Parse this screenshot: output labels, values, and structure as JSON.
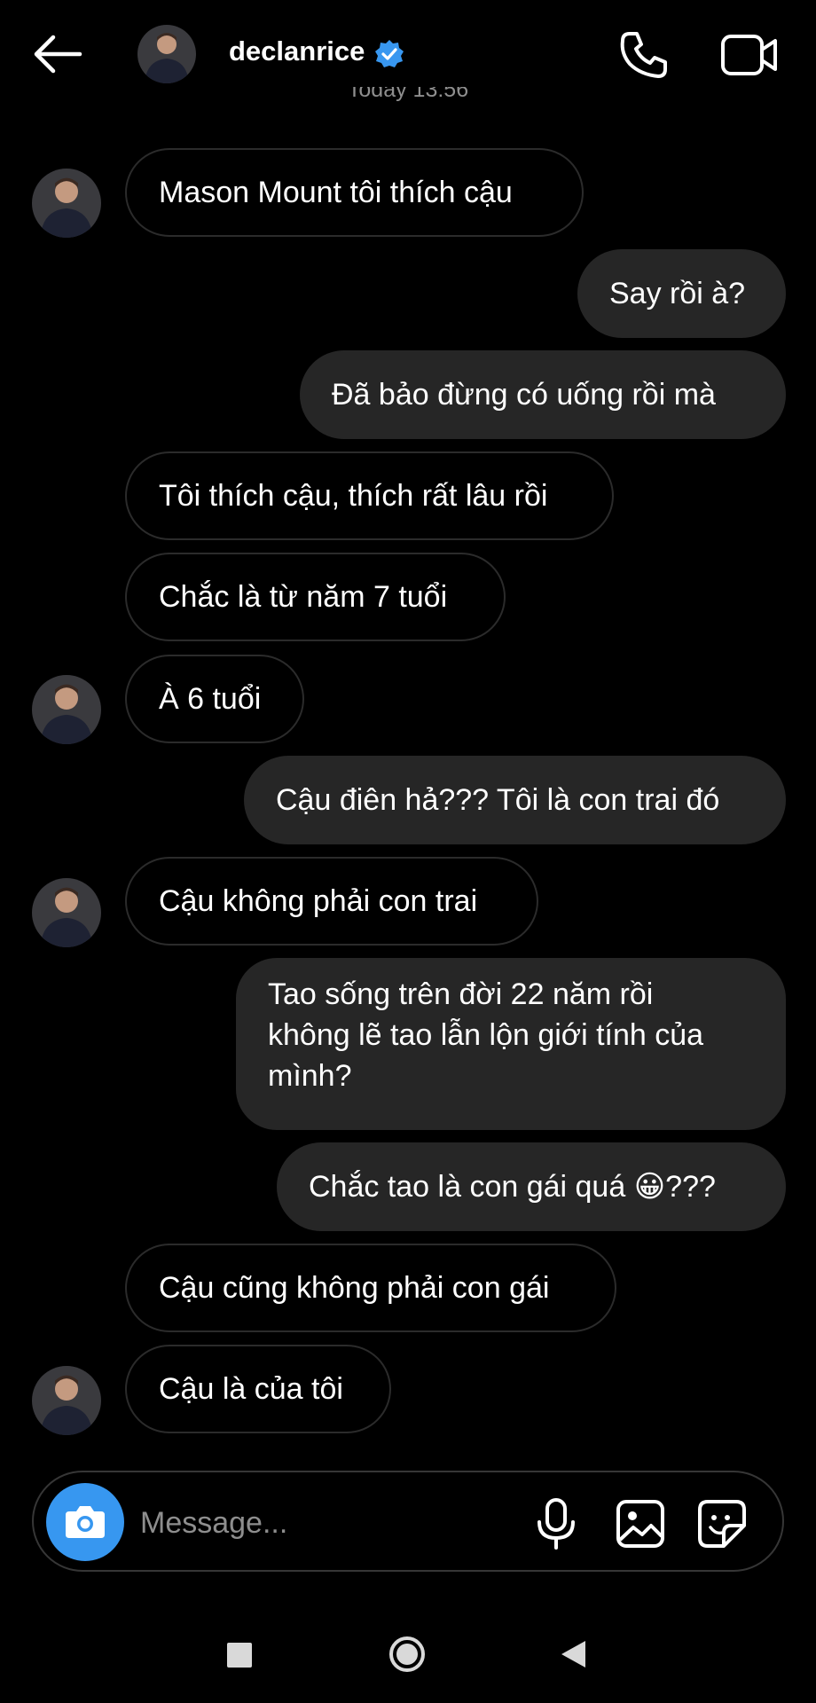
{
  "header": {
    "username": "declanrice",
    "timestamp_partial": "Today 13:56"
  },
  "messages": [
    {
      "dir": "in",
      "text": "Mason Mount tôi thích cậu"
    },
    {
      "dir": "out",
      "text": "Say rồi à?"
    },
    {
      "dir": "out",
      "text": "Đã bảo đừng có uống rồi mà"
    },
    {
      "dir": "in",
      "text": "Tôi thích cậu, thích rất lâu rồi"
    },
    {
      "dir": "in",
      "text": "Chắc là từ năm 7 tuổi"
    },
    {
      "dir": "in",
      "text": "À 6 tuổi"
    },
    {
      "dir": "out",
      "text": "Cậu điên hả??? Tôi là con trai đó"
    },
    {
      "dir": "in",
      "text": "Cậu không phải con trai"
    },
    {
      "dir": "out",
      "text_lines": [
        "Tao sống trên đời 22 năm rồi",
        "không lẽ tao lẫn lộn giới tính của",
        "mình?"
      ]
    },
    {
      "dir": "out",
      "text_before_emoji": "Chắc tao là con gái quá ",
      "emoji": "😀",
      "text_after_emoji": "???"
    },
    {
      "dir": "in",
      "text": "Cậu cũng không phải con gái"
    },
    {
      "dir": "in",
      "text": "Cậu là của tôi"
    }
  ],
  "composer": {
    "placeholder": "Message..."
  },
  "icons": {
    "back": "arrow-left-icon",
    "verified": "verified-badge-icon",
    "call": "phone-icon",
    "video": "video-camera-icon",
    "camera": "camera-icon",
    "mic": "microphone-icon",
    "gallery": "image-icon",
    "sticker": "sticker-icon"
  },
  "colors": {
    "background": "#000000",
    "outgoing_bubble": "#262626",
    "incoming_border": "#2b2b2b",
    "camera_button": "#3797f0",
    "verified": "#3897f0",
    "placeholder": "#8e8e8e"
  }
}
